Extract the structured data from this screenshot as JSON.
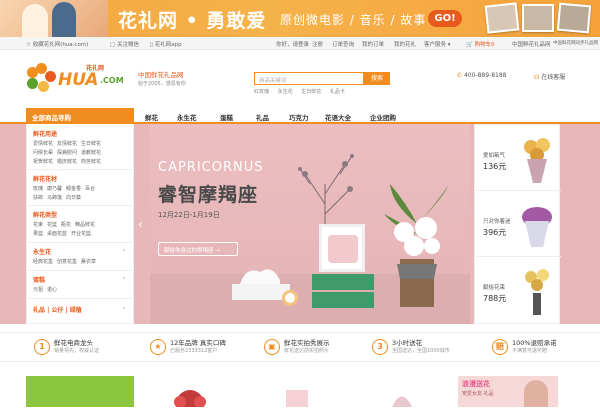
{
  "promo": {
    "brand": "花礼网",
    "dot": "•",
    "slogan": "勇敢爱",
    "subtitle": "原创微电影 / 音乐 / 故事",
    "go_label": "GO!"
  },
  "util": {
    "favorite": "收藏花礼网(hua.com)",
    "follow": "关注微信",
    "app": "花礼网app",
    "greeting": "你好，请登录",
    "register": "注册",
    "order_query": "订单查询",
    "my_orders": "我的订单",
    "my_hua": "我的花礼",
    "customer_service": "客户服务",
    "cart": "购物车",
    "cart_count": "0",
    "brand_flower": "中国鲜花礼品网",
    "brand_hua": "中国鲜花网同步礼品网"
  },
  "logo": {
    "cn": "花礼网",
    "word": "HUA",
    "com": ".COM"
  },
  "header": {
    "slogan": "中国鲜花礼品网",
    "since": "始于2005，感恩有你",
    "search_placeholder": "商品关键词",
    "search_button": "搜索",
    "hot_words": [
      "红玫瑰",
      "永生花",
      "生日鲜花",
      "礼品卡"
    ],
    "phone": "400-889-8188",
    "service": "在线客服"
  },
  "nav": {
    "all_categories": "全部商品导购",
    "items": [
      "鲜花",
      "永生花",
      "蛋糕",
      "礼品",
      "巧克力",
      "花语大全",
      "企业团购"
    ]
  },
  "sidebar": {
    "groups": [
      {
        "title": "鲜花用途",
        "rows": [
          [
            "爱情鲜花",
            "友情鲜花",
            "生日鲜花"
          ],
          [
            "问候长辈",
            "探病慰问",
            "道歉鲜花"
          ],
          [
            "祝贺鲜花",
            "婚庆鲜花",
            "商务鲜花"
          ]
        ]
      },
      {
        "title": "鲜花花材",
        "rows": [
          [
            "玫瑰",
            "康乃馨",
            "郁金香",
            "百合"
          ],
          [
            "扶郎",
            "马蹄莲",
            "向日葵"
          ]
        ]
      },
      {
        "title": "鲜花类型",
        "rows": [
          [
            "花束",
            "花篮",
            "瓶花",
            "精品鲜花"
          ],
          [
            "果篮",
            "桌面花蓝",
            "开业花篮"
          ]
        ]
      },
      {
        "title": "永生花",
        "rows": [
          [
            "经典花盒",
            "创意花盒",
            "薰衣草"
          ]
        ]
      },
      {
        "title": "蛋糕",
        "rows": [
          [
            "元祖",
            "诺心"
          ]
        ]
      },
      {
        "title": "礼品 | 公仔 | 绿植",
        "rows": []
      }
    ]
  },
  "hero": {
    "en_title": "CAPRICORNUS",
    "cn_title": "睿智摩羯座",
    "date_range": "12月22日-1月19日",
    "cta": "献给你身边的摩羯座 →",
    "arrow": "‹"
  },
  "featured": [
    {
      "name": "爱如氧气",
      "price": "136元",
      "color": "#e9b24b"
    },
    {
      "name": "只对你着迷",
      "price": "396元",
      "color": "#a35aa3"
    },
    {
      "name": "献给花束",
      "price": "788元",
      "color": "#e8c25a"
    }
  ],
  "features": [
    {
      "icon": "1",
      "title": "鲜花电商龙头",
      "sub": "销量领先，权威认证"
    },
    {
      "icon": "★",
      "title": "12年品牌 真实口碑",
      "sub": "已服务2333312客户"
    },
    {
      "icon": "▣",
      "title": "鲜花实拍秀展示",
      "sub": "鲜花送达前实拍照片"
    },
    {
      "icon": "3",
      "title": "3小时送花",
      "sub": "全国送达，全国1000城市"
    },
    {
      "icon": "赔",
      "title": "100%退赔承诺",
      "sub": "不满意可退可赔"
    }
  ],
  "bottom": {
    "promo_title": "浪漫送花",
    "promo_sub": "宠爱女友·礼品"
  },
  "colors": {
    "accent": "#f18c1e",
    "accent_dark": "#e85a1c",
    "hero_bg": "#e8b7ba",
    "green": "#5aa02c"
  }
}
